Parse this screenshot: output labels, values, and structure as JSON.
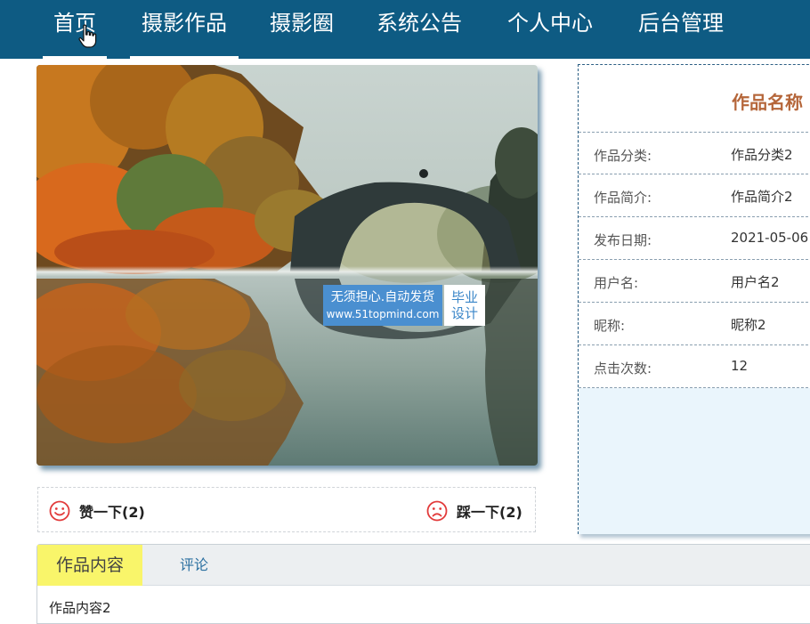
{
  "nav": {
    "items": [
      {
        "label": "首页"
      },
      {
        "label": "摄影作品"
      },
      {
        "label": "摄影圈"
      },
      {
        "label": "系统公告"
      },
      {
        "label": "个人中心"
      },
      {
        "label": "后台管理"
      }
    ]
  },
  "photo": {
    "watermark_line1": "无须担心.自动发货",
    "watermark_line2": "www.51topmind.com",
    "watermark_tag_line1": "毕业",
    "watermark_tag_line2": "设计"
  },
  "votes": {
    "like_label": "赞一下(2)",
    "dislike_label": "踩一下(2)"
  },
  "info": {
    "title": "作品名称",
    "rows": [
      {
        "key": "作品分类:",
        "value": "作品分类2"
      },
      {
        "key": "作品简介:",
        "value": "作品简介2"
      },
      {
        "key": "发布日期:",
        "value": "2021-05-06"
      },
      {
        "key": "用户名:",
        "value": "用户名2"
      },
      {
        "key": "昵称:",
        "value": "昵称2"
      },
      {
        "key": "点击次数:",
        "value": "12"
      }
    ]
  },
  "tabs": {
    "items": [
      {
        "label": "作品内容",
        "active": true
      },
      {
        "label": "评论",
        "active": false
      }
    ],
    "content": "作品内容2"
  },
  "colors": {
    "nav_bg": "#0e5b83",
    "title_color": "#b5663a",
    "active_tab_bg": "#f9f56a",
    "vote_icon": "#e23b3b"
  }
}
